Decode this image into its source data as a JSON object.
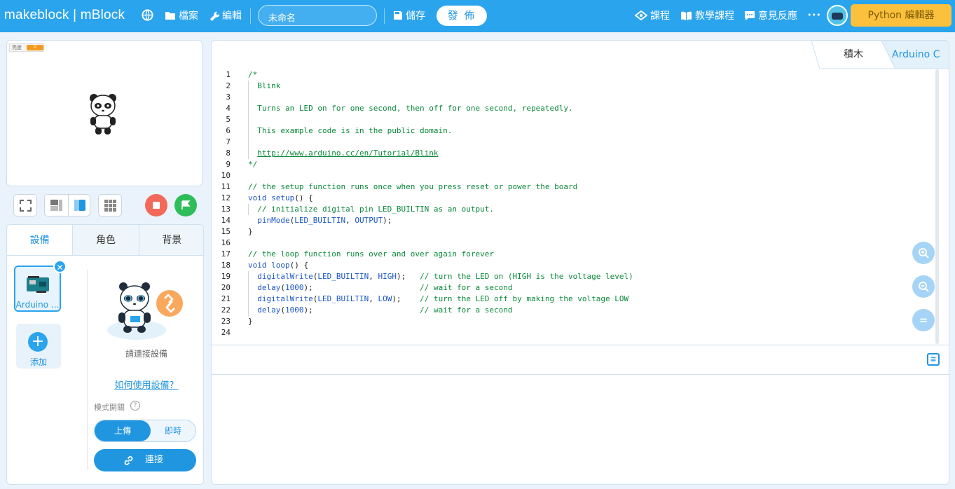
{
  "topbar": {
    "brand": "makeblock | mBlock",
    "file_label": "檔案",
    "edit_label": "編輯",
    "project_name": "未命名",
    "save_label": "儲存",
    "publish_label": "發 佈",
    "courses_label": "課程",
    "tutorials_label": "教學課程",
    "feedback_label": "意見反應",
    "more_label": "•••",
    "python_editor_label": "Python 編輯器"
  },
  "stage": {
    "brightness_label": "亮度",
    "brightness_value": "0"
  },
  "panel": {
    "tabs": [
      "設備",
      "角色",
      "背景"
    ],
    "device_name": "Arduino ...",
    "add_label": "添加",
    "connect_hint": "請連接設備",
    "howto_link": "如何使用設備？",
    "mode_label": "模式開關",
    "mode_upload": "上傳",
    "mode_live": "即時",
    "connect_button": "連接"
  },
  "editor": {
    "tabs": [
      "積木",
      "Arduino C"
    ],
    "lines": [
      {
        "n": "1",
        "html": "/*"
      },
      {
        "n": "2",
        "html": "  Blink"
      },
      {
        "n": "3",
        "html": ""
      },
      {
        "n": "4",
        "html": "  Turns an LED on for one second, then off for one second, repeatedly."
      },
      {
        "n": "5",
        "html": ""
      },
      {
        "n": "6",
        "html": "  This example code is in the public domain."
      },
      {
        "n": "7",
        "html": ""
      },
      {
        "n": "8",
        "html": "  <span class=\"u\">http://www.arduino.cc/en/Tutorial/Blink</span>"
      },
      {
        "n": "9",
        "html": "*/"
      },
      {
        "n": "10",
        "html": ""
      },
      {
        "n": "11",
        "html": "// the setup function runs once when you press reset or power the board"
      },
      {
        "n": "12",
        "html": "<span class=\"kw\">void</span> <span class=\"fn\">setup</span><span class=\"p\">() {</span>"
      },
      {
        "n": "13",
        "html": "  // initialize digital pin LED_BUILTIN as an output."
      },
      {
        "n": "14",
        "html": "  <span class=\"fn\">pinMode</span><span class=\"p\">(</span><span class=\"kw\">LED_BUILTIN</span><span class=\"p\">, </span><span class=\"kw\">OUTPUT</span><span class=\"p\">);</span>"
      },
      {
        "n": "15",
        "html": "<span class=\"p\">}</span>"
      },
      {
        "n": "16",
        "html": ""
      },
      {
        "n": "17",
        "html": "// the loop function runs over and over again forever"
      },
      {
        "n": "18",
        "html": "<span class=\"kw\">void</span> <span class=\"fn\">loop</span><span class=\"p\">() {</span>"
      },
      {
        "n": "19",
        "html": "  <span class=\"fn\">digitalWrite</span><span class=\"p\">(</span><span class=\"kw\">LED_BUILTIN</span><span class=\"p\">, </span><span class=\"kw\">HIGH</span><span class=\"p\">);   </span>// turn the LED on (HIGH is the voltage level)"
      },
      {
        "n": "20",
        "html": "  <span class=\"fn\">delay</span><span class=\"p\">(</span><span class=\"kw\">1000</span><span class=\"p\">);                       </span>// wait for a second"
      },
      {
        "n": "21",
        "html": "  <span class=\"fn\">digitalWrite</span><span class=\"p\">(</span><span class=\"kw\">LED_BUILTIN</span><span class=\"p\">, </span><span class=\"kw\">LOW</span><span class=\"p\">);    </span>// turn the LED off by making the voltage LOW"
      },
      {
        "n": "22",
        "html": "  <span class=\"fn\">delay</span><span class=\"p\">(</span><span class=\"kw\">1000</span><span class=\"p\">);                       </span>// wait for a second"
      },
      {
        "n": "23",
        "html": "<span class=\"p\">}</span>"
      },
      {
        "n": "24",
        "html": ""
      }
    ]
  },
  "colors": {
    "topbar": "#2ba4ee",
    "accent": "#2196e0",
    "python_button": "#fbc03c",
    "stop_button": "#f2695a",
    "go_button": "#2ebd59",
    "code_comment": "#0b8a3a",
    "code_keyword": "#1a56c6"
  },
  "icons": {
    "globe": "globe-icon",
    "folder": "folder-icon",
    "wrench": "wrench-icon",
    "save": "save-icon",
    "courses": "graduation-icon",
    "tutorials": "book-icon",
    "feedback": "chat-icon",
    "fullscreen": "fullscreen-icon",
    "stop": "stop-icon",
    "flag": "flag-icon",
    "zoom_in": "zoom-in-icon",
    "zoom_out": "zoom-out-icon",
    "zoom_reset": "zoom-reset-icon",
    "link": "link-icon"
  }
}
